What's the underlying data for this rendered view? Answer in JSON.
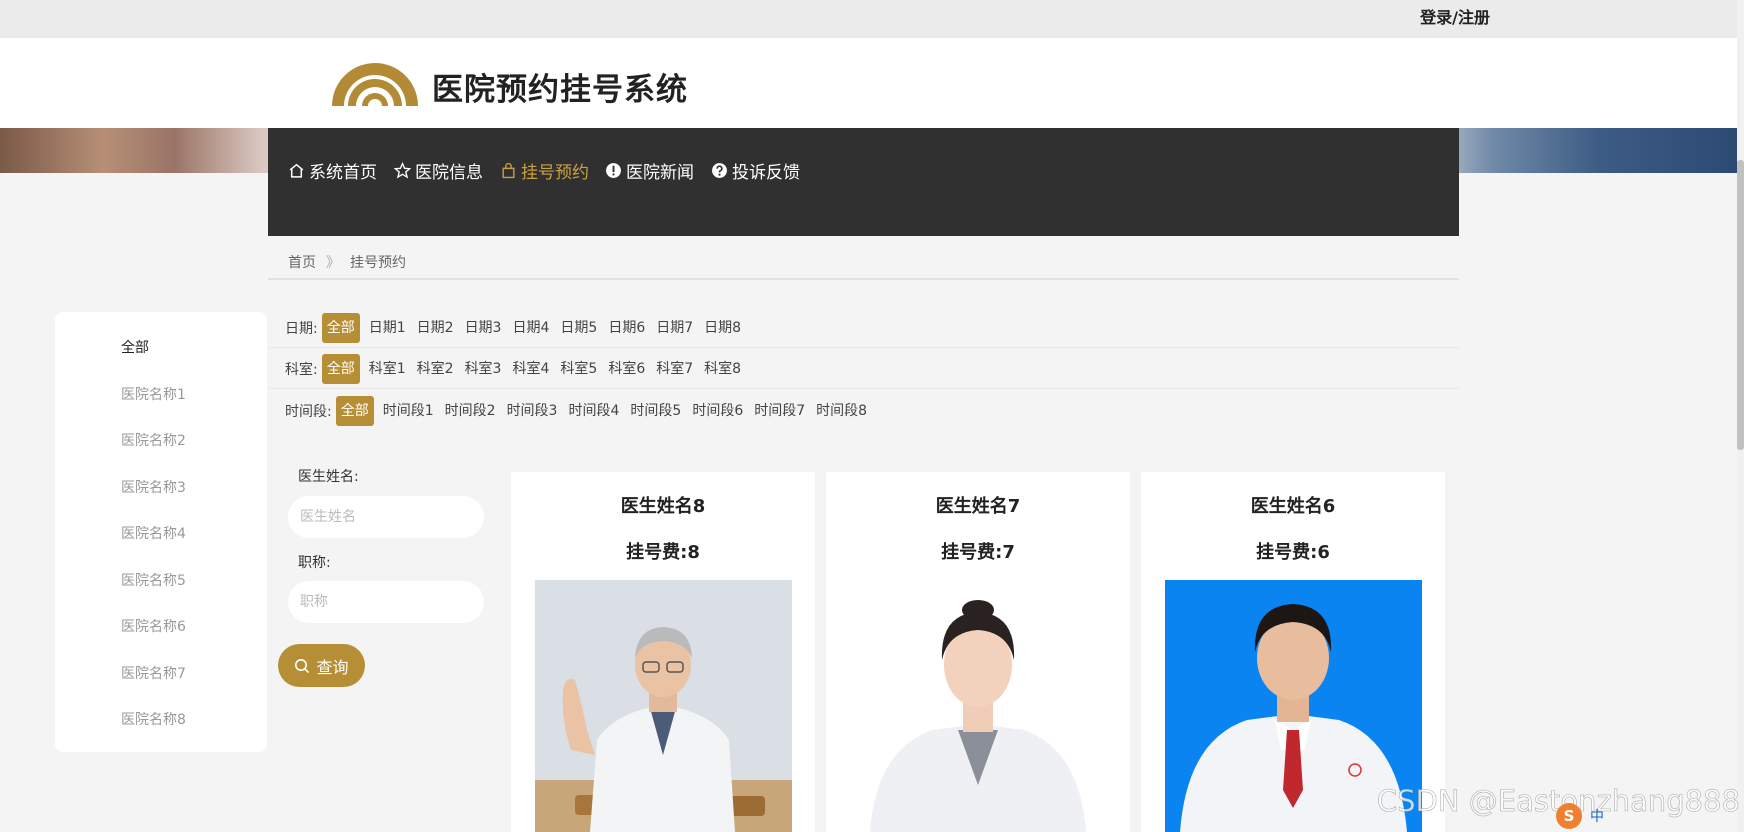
{
  "topbar": {
    "login_label": "登录/注册"
  },
  "header": {
    "site_title": "医院预约挂号系统"
  },
  "nav": {
    "items": [
      {
        "label": "系统首页",
        "icon": "home-icon"
      },
      {
        "label": "医院信息",
        "icon": "star-icon"
      },
      {
        "label": "挂号预约",
        "icon": "bag-icon",
        "active": true
      },
      {
        "label": "医院新闻",
        "icon": "alert-icon"
      },
      {
        "label": "投诉反馈",
        "icon": "question-icon"
      }
    ],
    "active_color": "#c9a03f"
  },
  "breadcrumb": {
    "home": "首页",
    "separator": "》",
    "current": "挂号预约"
  },
  "sidebar": {
    "items": [
      "全部",
      "医院名称1",
      "医院名称2",
      "医院名称3",
      "医院名称4",
      "医院名称5",
      "医院名称6",
      "医院名称7",
      "医院名称8"
    ]
  },
  "filters": {
    "date": {
      "label": "日期:",
      "options": [
        "全部",
        "日期1",
        "日期2",
        "日期3",
        "日期4",
        "日期5",
        "日期6",
        "日期7",
        "日期8"
      ]
    },
    "department": {
      "label": "科室:",
      "options": [
        "全部",
        "科室1",
        "科室2",
        "科室3",
        "科室4",
        "科室5",
        "科室6",
        "科室7",
        "科室8"
      ]
    },
    "timeslot": {
      "label": "时间段:",
      "options": [
        "全部",
        "时间段1",
        "时间段2",
        "时间段3",
        "时间段4",
        "时间段5",
        "时间段6",
        "时间段7",
        "时间段8"
      ]
    }
  },
  "search": {
    "doctor_label": "医生姓名:",
    "doctor_placeholder": "医生姓名",
    "title_label": "职称:",
    "title_placeholder": "职称",
    "button_label": "查询"
  },
  "doctors": [
    {
      "name": "医生姓名8",
      "fee": "挂号费:8"
    },
    {
      "name": "医生姓名7",
      "fee": "挂号费:7"
    },
    {
      "name": "医生姓名6",
      "fee": "挂号费:6"
    }
  ],
  "watermark": "CSDN @Eastonzhang888",
  "ime": {
    "lang": "中"
  },
  "colors": {
    "accent": "#b58e35",
    "nav_bg": "#303030",
    "photo_blue_bg": "#0a84f0"
  }
}
